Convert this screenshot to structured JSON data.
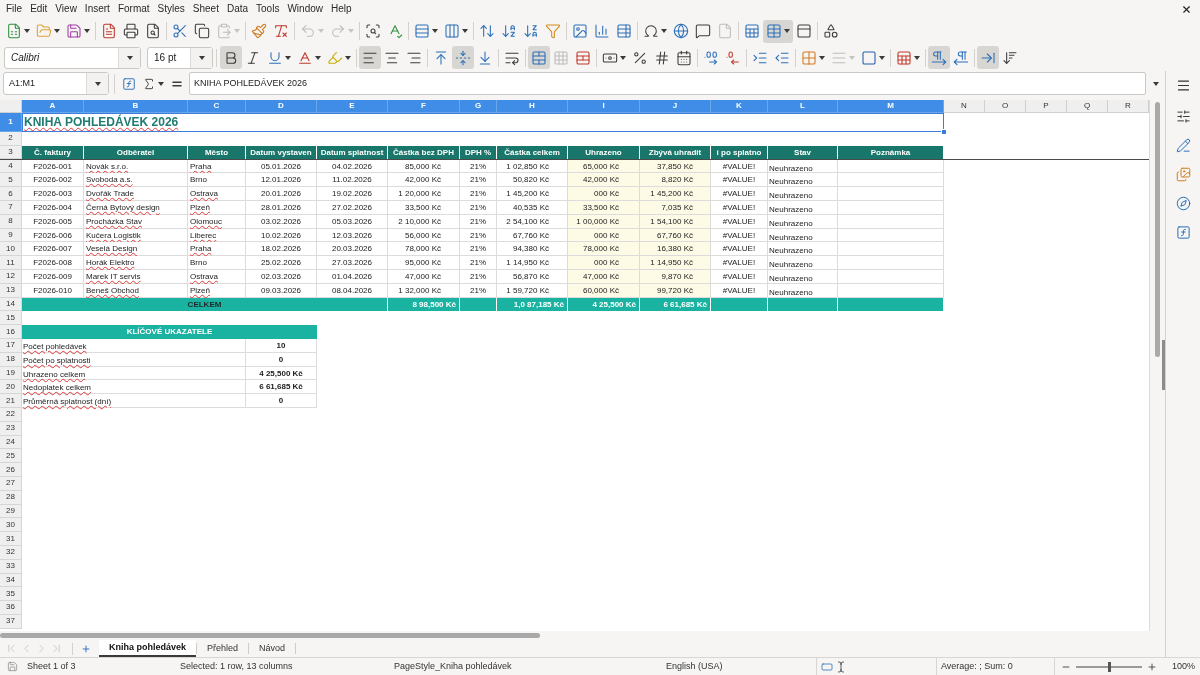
{
  "menu_bar": [
    "File",
    "Edit",
    "View",
    "Insert",
    "Format",
    "Styles",
    "Sheet",
    "Data",
    "Tools",
    "Window",
    "Help"
  ],
  "standard_toolbar": [
    [
      {
        "kind": "new",
        "active": false,
        "disabled": false
      },
      {
        "kind": "open",
        "active": false,
        "disabled": false
      },
      {
        "kind": "save",
        "active": false,
        "disabled": false
      }
    ],
    [
      {
        "kind": "export_pdf",
        "active": false,
        "disabled": false
      },
      {
        "kind": "print",
        "active": false,
        "disabled": false
      },
      {
        "kind": "print_preview",
        "active": false,
        "disabled": false
      }
    ],
    [
      {
        "kind": "cut",
        "active": false,
        "disabled": false
      },
      {
        "kind": "copy",
        "active": false,
        "disabled": false
      },
      {
        "kind": "paste",
        "active": false,
        "disabled": true
      }
    ],
    [
      {
        "kind": "clone_formatting",
        "active": false,
        "disabled": false
      },
      {
        "kind": "clear_formatting",
        "active": false,
        "disabled": false
      }
    ],
    [
      {
        "kind": "undo",
        "active": false,
        "disabled": true
      },
      {
        "kind": "redo",
        "active": false,
        "disabled": true
      }
    ],
    [
      {
        "kind": "find_replace",
        "active": false,
        "disabled": false
      },
      {
        "kind": "spelling",
        "active": false,
        "disabled": false
      }
    ],
    [
      {
        "kind": "row",
        "active": false,
        "disabled": false
      },
      {
        "kind": "column",
        "active": false,
        "disabled": false
      }
    ],
    [
      {
        "kind": "sort",
        "active": false,
        "disabled": false
      },
      {
        "kind": "sort_ascending",
        "active": false,
        "disabled": false
      },
      {
        "kind": "sort_descending",
        "active": false,
        "disabled": false
      },
      {
        "kind": "autofilter",
        "active": false,
        "disabled": false
      }
    ],
    [
      {
        "kind": "image",
        "active": false,
        "disabled": false
      },
      {
        "kind": "chart",
        "active": false,
        "disabled": false
      },
      {
        "kind": "pivot_table",
        "active": false,
        "disabled": false
      }
    ],
    [
      {
        "kind": "special_character",
        "active": false,
        "disabled": false
      },
      {
        "kind": "hyperlink",
        "active": false,
        "disabled": false
      },
      {
        "kind": "comment",
        "active": false,
        "disabled": false
      },
      {
        "kind": "header_footer",
        "active": false,
        "disabled": true
      }
    ],
    [
      {
        "kind": "print_range",
        "active": false,
        "disabled": false
      },
      {
        "kind": "freeze",
        "active": true,
        "disabled": false
      },
      {
        "kind": "split_window",
        "active": false,
        "disabled": false
      }
    ],
    [
      {
        "kind": "draw_functions",
        "active": false,
        "disabled": false
      }
    ]
  ],
  "formatting_toolbar": {
    "font_name": "Calibri",
    "font_size": "16 pt",
    "groups": [
      [
        {
          "kind": "bold",
          "active": true,
          "disabled": false
        },
        {
          "kind": "italic",
          "active": false,
          "disabled": false
        },
        {
          "kind": "underline",
          "active": false,
          "disabled": false
        },
        {
          "kind": "font_color",
          "active": false,
          "disabled": false
        },
        {
          "kind": "highlighting",
          "active": false,
          "disabled": false
        }
      ],
      [
        {
          "kind": "align_left",
          "active": true,
          "disabled": false
        },
        {
          "kind": "align_center",
          "active": false,
          "disabled": false
        },
        {
          "kind": "align_right",
          "active": false,
          "disabled": false
        }
      ],
      [
        {
          "kind": "align_top",
          "active": false,
          "disabled": false
        },
        {
          "kind": "center_vertically",
          "active": true,
          "disabled": false
        },
        {
          "kind": "align_bottom",
          "active": false,
          "disabled": false
        }
      ],
      [
        {
          "kind": "wrap_text",
          "active": false,
          "disabled": false
        }
      ],
      [
        {
          "kind": "merge_center",
          "active": true,
          "disabled": false
        },
        {
          "kind": "merge_cells",
          "active": false,
          "disabled": true
        },
        {
          "kind": "unmerge_cells",
          "active": false,
          "disabled": false
        }
      ],
      [
        {
          "kind": "currency",
          "active": false,
          "disabled": false
        },
        {
          "kind": "percent",
          "active": false,
          "disabled": false
        },
        {
          "kind": "number_format",
          "active": false,
          "disabled": false
        },
        {
          "kind": "date_format",
          "active": false,
          "disabled": false
        }
      ],
      [
        {
          "kind": "add_decimal",
          "active": false,
          "disabled": false
        },
        {
          "kind": "delete_decimal",
          "active": false,
          "disabled": false
        }
      ],
      [
        {
          "kind": "indent_more",
          "active": false,
          "disabled": false
        },
        {
          "kind": "indent_less",
          "active": false,
          "disabled": false
        }
      ],
      [
        {
          "kind": "borders",
          "active": false,
          "disabled": false
        },
        {
          "kind": "border_style",
          "active": false,
          "disabled": true
        },
        {
          "kind": "border_color",
          "active": false,
          "disabled": false
        }
      ],
      [
        {
          "kind": "conditional",
          "active": false,
          "disabled": false
        }
      ],
      [
        {
          "kind": "left_to_right",
          "active": true,
          "disabled": false
        },
        {
          "kind": "right_to_left",
          "active": false,
          "disabled": false
        }
      ],
      [
        {
          "kind": "text_orientation",
          "active": true,
          "disabled": false
        },
        {
          "kind": "vertical_text",
          "active": false,
          "disabled": false
        }
      ]
    ]
  },
  "formula_bar": {
    "name_box": "A1:M1",
    "content": "KNIHA POHLEDÁVEK 2026"
  },
  "column_headers": [
    {
      "label": "A",
      "selected": true
    },
    {
      "label": "B",
      "selected": true
    },
    {
      "label": "C",
      "selected": true
    },
    {
      "label": "D",
      "selected": true
    },
    {
      "label": "E",
      "selected": true
    },
    {
      "label": "F",
      "selected": true
    },
    {
      "label": "G",
      "selected": true
    },
    {
      "label": "H",
      "selected": true
    },
    {
      "label": "I",
      "selected": true
    },
    {
      "label": "J",
      "selected": true
    },
    {
      "label": "K",
      "selected": true
    },
    {
      "label": "L",
      "selected": true
    },
    {
      "label": "M",
      "selected": true
    },
    {
      "label": "N",
      "selected": false
    },
    {
      "label": "O",
      "selected": false
    },
    {
      "label": "P",
      "selected": false
    },
    {
      "label": "Q",
      "selected": false
    },
    {
      "label": "R",
      "selected": false
    }
  ],
  "row_headers": [
    {
      "label": "1",
      "selected": true
    },
    {
      "label": "2",
      "selected": false
    },
    {
      "label": "3",
      "selected": false
    },
    {
      "label": "4",
      "selected": false
    },
    {
      "label": "5",
      "selected": false
    },
    {
      "label": "6",
      "selected": false
    },
    {
      "label": "7",
      "selected": false
    },
    {
      "label": "8",
      "selected": false
    },
    {
      "label": "9",
      "selected": false
    },
    {
      "label": "10",
      "selected": false
    },
    {
      "label": "11",
      "selected": false
    },
    {
      "label": "12",
      "selected": false
    },
    {
      "label": "13",
      "selected": false
    },
    {
      "label": "14",
      "selected": false
    },
    {
      "label": "15",
      "selected": false
    },
    {
      "label": "16",
      "selected": false
    },
    {
      "label": "17",
      "selected": false
    },
    {
      "label": "18",
      "selected": false
    },
    {
      "label": "19",
      "selected": false
    },
    {
      "label": "20",
      "selected": false
    },
    {
      "label": "21",
      "selected": false
    },
    {
      "label": "22",
      "selected": false
    },
    {
      "label": "23",
      "selected": false
    },
    {
      "label": "24",
      "selected": false
    },
    {
      "label": "25",
      "selected": false
    },
    {
      "label": "26",
      "selected": false
    },
    {
      "label": "27",
      "selected": false
    },
    {
      "label": "28",
      "selected": false
    },
    {
      "label": "29",
      "selected": false
    },
    {
      "label": "30",
      "selected": false
    },
    {
      "label": "31",
      "selected": false
    },
    {
      "label": "32",
      "selected": false
    },
    {
      "label": "33",
      "selected": false
    },
    {
      "label": "34",
      "selected": false
    },
    {
      "label": "35",
      "selected": false
    },
    {
      "label": "36",
      "selected": false
    },
    {
      "label": "37",
      "selected": false
    }
  ],
  "sheet": {
    "title": {
      "text": "KNIHA POHLEDÁVEK 2026",
      "spell_error": true
    },
    "table": {
      "columns": [
        "Č. faktury",
        "Odběratel",
        "Město",
        "Datum vystaven",
        "Datum splatnost",
        "Částka bez DPH",
        "DPH %",
        "Částka celkem",
        "Uhrazeno",
        "Zbývá uhradit",
        "í po splatno",
        "Stav",
        "Poznámka"
      ],
      "rows": [
        {
          "cells": [
            "F2026-001",
            "Novák s.r.o.",
            "Praha",
            "05.01.2026",
            "04.02.2026",
            "85,000 Kč",
            "21%",
            "1 02,850 Kč",
            "65,000 Kč",
            "37,850 Kč",
            "#VALUE!",
            "Neuhrazeno"
          ],
          "customer_spell_error": true,
          "city_spell_error": true
        },
        {
          "cells": [
            "F2026-002",
            "Svoboda a.s.",
            "Brno",
            "12.01.2026",
            "11.02.2026",
            "42,000 Kč",
            "21%",
            "50,820 Kč",
            "42,000 Kč",
            "8,820 Kč",
            "#VALUE!",
            "Neuhrazeno"
          ],
          "customer_spell_error": true,
          "city_spell_error": false
        },
        {
          "cells": [
            "F2026-003",
            "Dvořák Trade",
            "Ostrava",
            "20.01.2026",
            "19.02.2026",
            "1 20,000 Kč",
            "21%",
            "1 45,200 Kč",
            "000 Kč",
            "1 45,200 Kč",
            "#VALUE!",
            "Neuhrazeno"
          ],
          "customer_spell_error": true,
          "city_spell_error": true
        },
        {
          "cells": [
            "F2026-004",
            "Černá Bytový design",
            "Plzeň",
            "28.01.2026",
            "27.02.2026",
            "33,500 Kč",
            "21%",
            "40,535 Kč",
            "33,500 Kč",
            "7,035 Kč",
            "#VALUE!",
            "Neuhrazeno"
          ],
          "customer_spell_error": true,
          "city_spell_error": true
        },
        {
          "cells": [
            "F2026-005",
            "Procházka Stav",
            "Olomouc",
            "03.02.2026",
            "05.03.2026",
            "2 10,000 Kč",
            "21%",
            "2 54,100 Kč",
            "1 00,000 Kč",
            "1 54,100 Kč",
            "#VALUE!",
            "Neuhrazeno"
          ],
          "customer_spell_error": true,
          "city_spell_error": true
        },
        {
          "cells": [
            "F2026-006",
            "Kučera Logistik",
            "Liberec",
            "10.02.2026",
            "12.03.2026",
            "56,000 Kč",
            "21%",
            "67,760 Kč",
            "000 Kč",
            "67,760 Kč",
            "#VALUE!",
            "Neuhrazeno"
          ],
          "customer_spell_error": true,
          "city_spell_error": true
        },
        {
          "cells": [
            "F2026-007",
            "Veselá Design",
            "Praha",
            "18.02.2026",
            "20.03.2026",
            "78,000 Kč",
            "21%",
            "94,380 Kč",
            "78,000 Kč",
            "16,380 Kč",
            "#VALUE!",
            "Neuhrazeno"
          ],
          "customer_spell_error": true,
          "city_spell_error": true
        },
        {
          "cells": [
            "F2026-008",
            "Horák Elektro",
            "Brno",
            "25.02.2026",
            "27.03.2026",
            "95,000 Kč",
            "21%",
            "1 14,950 Kč",
            "000 Kč",
            "1 14,950 Kč",
            "#VALUE!",
            "Neuhrazeno"
          ],
          "customer_spell_error": true,
          "city_spell_error": false
        },
        {
          "cells": [
            "F2026-009",
            "Marek IT servis",
            "Ostrava",
            "02.03.2026",
            "01.04.2026",
            "47,000 Kč",
            "21%",
            "56,870 Kč",
            "47,000 Kč",
            "9,870 Kč",
            "#VALUE!",
            "Neuhrazeno"
          ],
          "customer_spell_error": true,
          "city_spell_error": true
        },
        {
          "cells": [
            "F2026-010",
            "Beneš Obchod",
            "Plzeň",
            "09.03.2026",
            "08.04.2026",
            "1 32,000 Kč",
            "21%",
            "1 59,720 Kč",
            "60,000 Kč",
            "99,720 Kč",
            "#VALUE!",
            "Neuhrazeno"
          ],
          "customer_spell_error": true,
          "city_spell_error": true
        }
      ],
      "total": {
        "label": "CELKEM",
        "net": "8 98,500 Kč",
        "gross": "1,0 87,185 Kč",
        "paid": "4 25,500 Kč",
        "remaining": "6 61,685 Kč"
      }
    },
    "kpi": {
      "title": "KLÍČOVÉ UKAZATELE",
      "items": [
        {
          "label": "Počet pohledávek",
          "value": "10",
          "spell_error": true
        },
        {
          "label": "Počet po splatnosti",
          "value": "0",
          "spell_error": true
        },
        {
          "label": "Uhrazeno celkem",
          "value": "4 25,500 Kč",
          "spell_error": true
        },
        {
          "label": "Nedoplatek celkem",
          "value": "6 61,685 Kč",
          "spell_error": true
        },
        {
          "label": "Průměrná splatnost (dní)",
          "value": "0",
          "spell_error": true
        }
      ]
    }
  },
  "sidebar": [
    {
      "kind": "properties",
      "selected": false
    },
    {
      "kind": "styles",
      "selected": false
    },
    {
      "kind": "gallery",
      "selected": false
    },
    {
      "kind": "navigator",
      "selected": false
    },
    {
      "kind": "functions",
      "selected": false
    }
  ],
  "sheet_nav": [
    {
      "kind": "first",
      "disabled": true
    },
    {
      "kind": "previous",
      "disabled": true
    },
    {
      "kind": "next",
      "disabled": true
    },
    {
      "kind": "last",
      "disabled": true
    }
  ],
  "sheet_tabs": [
    {
      "label": "Kniha pohledávek",
      "selected": true
    },
    {
      "label": "Přehled",
      "selected": false
    },
    {
      "label": "Návod",
      "selected": false
    }
  ],
  "status_bar": {
    "sheet": "Sheet 1 of 3",
    "selection": "Selected: 1 row, 13 columns",
    "page_style": "PageStyle_Kniha pohledávek",
    "language": "English (USA)",
    "summary": "Average: ; Sum: 0",
    "zoom": {
      "level": 0.5,
      "reading": "100%"
    }
  }
}
